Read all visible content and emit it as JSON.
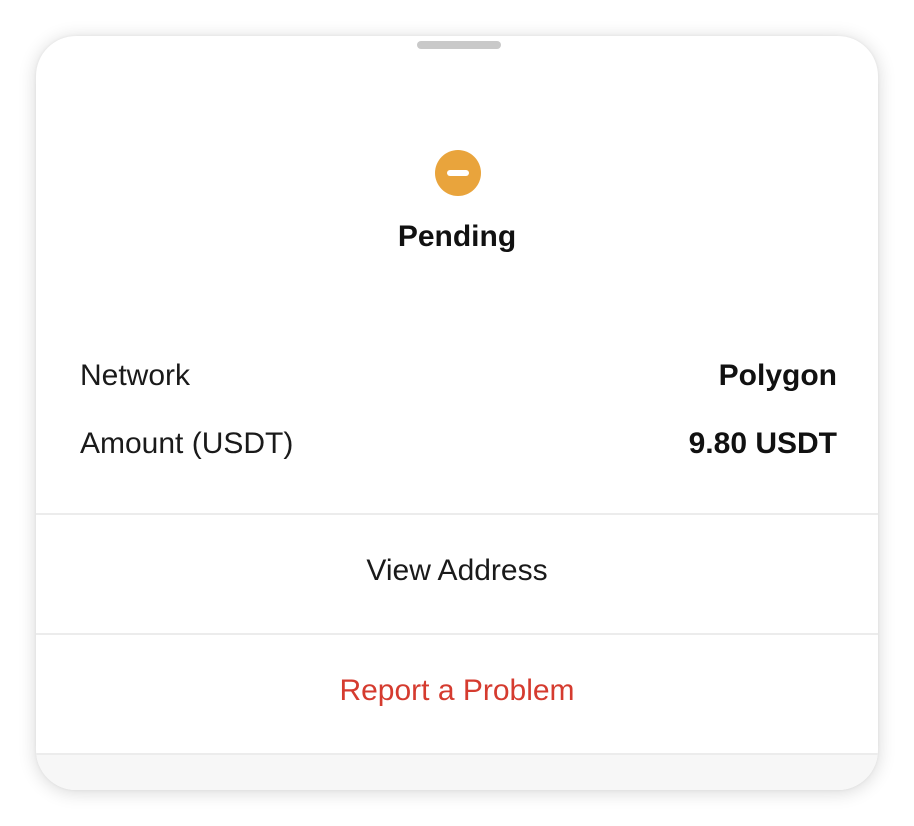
{
  "status": {
    "icon": "minus-circle-icon",
    "icon_color": "#e9a43c",
    "title": "Pending"
  },
  "details": [
    {
      "label": "Network",
      "value": "Polygon"
    },
    {
      "label": "Amount (USDT)",
      "value": "9.80 USDT"
    }
  ],
  "actions": {
    "view_address": "View Address",
    "report_problem": "Report a Problem"
  },
  "colors": {
    "danger": "#d53b2f",
    "pending": "#e9a43c"
  }
}
